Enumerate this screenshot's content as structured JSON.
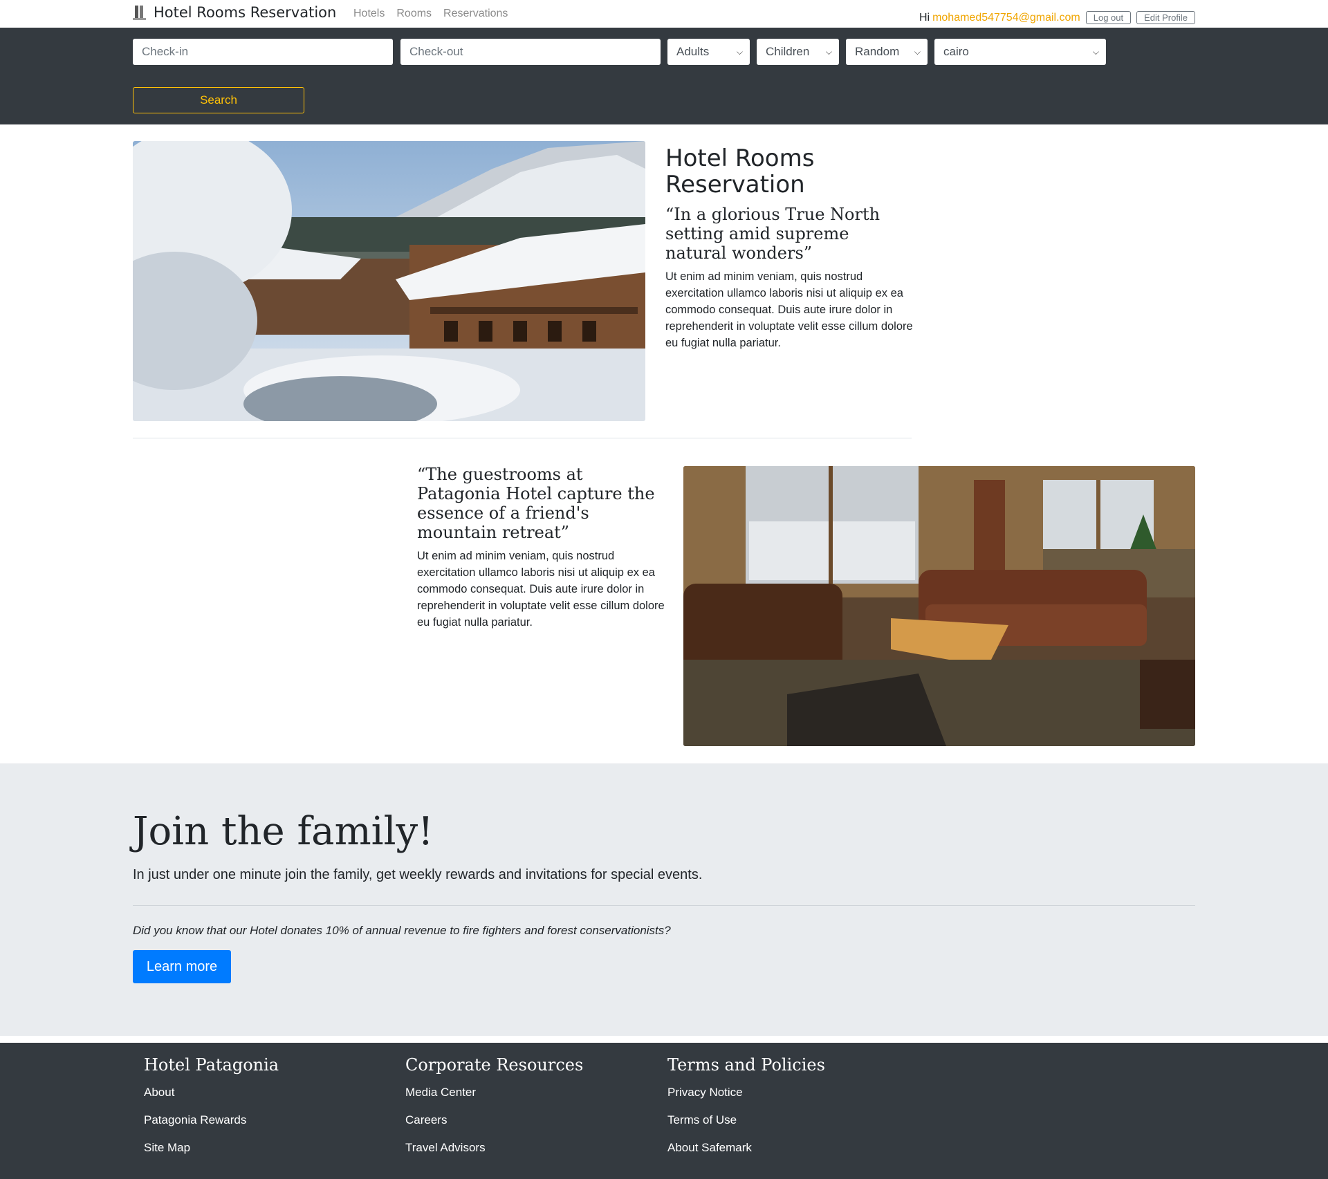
{
  "navbar": {
    "brand": "Hotel Rooms Reservation",
    "links": [
      "Hotels",
      "Rooms",
      "Reservations"
    ],
    "greeting": "Hi",
    "email": "mohamed547754@gmail.com",
    "logout": "Log out",
    "edit_profile": "Edit Profile"
  },
  "search": {
    "checkin_placeholder": "Check-in",
    "checkout_placeholder": "Check-out",
    "adults": "Adults",
    "children": "Children",
    "room_type": "Random",
    "city": "cairo",
    "button": "Search"
  },
  "feature1": {
    "title": "Hotel Rooms Reservation",
    "quote": "“In a glorious True North setting amid supreme natural wonders”",
    "text": "Ut enim ad minim veniam, quis nostrud exercitation ullamco laboris nisi ut aliquip ex ea commodo consequat. Duis aute irure dolor in reprehenderit in voluptate velit esse cillum dolore eu fugiat nulla pariatur."
  },
  "feature2": {
    "quote": "“The guestrooms at Patagonia Hotel capture the essence of a friend's mountain retreat”",
    "text": "Ut enim ad minim veniam, quis nostrud exercitation ullamco laboris nisi ut aliquip ex ea commodo consequat. Duis aute irure dolor in reprehenderit in voluptate velit esse cillum dolore eu fugiat nulla pariatur."
  },
  "join": {
    "title": "Join the family!",
    "lead": "In just under one minute join the family, get weekly rewards and invitations for special events.",
    "note": "Did you know that our Hotel donates 10% of annual revenue to fire fighters and forest conservationists?",
    "button": "Learn more"
  },
  "footer": {
    "col1": {
      "title": "Hotel Patagonia",
      "items": [
        "About",
        "Patagonia Rewards",
        "Site Map"
      ]
    },
    "col2": {
      "title": "Corporate Resources",
      "items": [
        "Media Center",
        "Careers",
        "Travel Advisors"
      ]
    },
    "col3": {
      "title": "Terms and Policies",
      "items": [
        "Privacy Notice",
        "Terms of Use",
        "About Safemark"
      ]
    }
  },
  "colors": {
    "dark": "#343a40",
    "accent": "#ffc107",
    "email": "#f0a500",
    "primary": "#007bff",
    "light": "#e9ecef"
  }
}
